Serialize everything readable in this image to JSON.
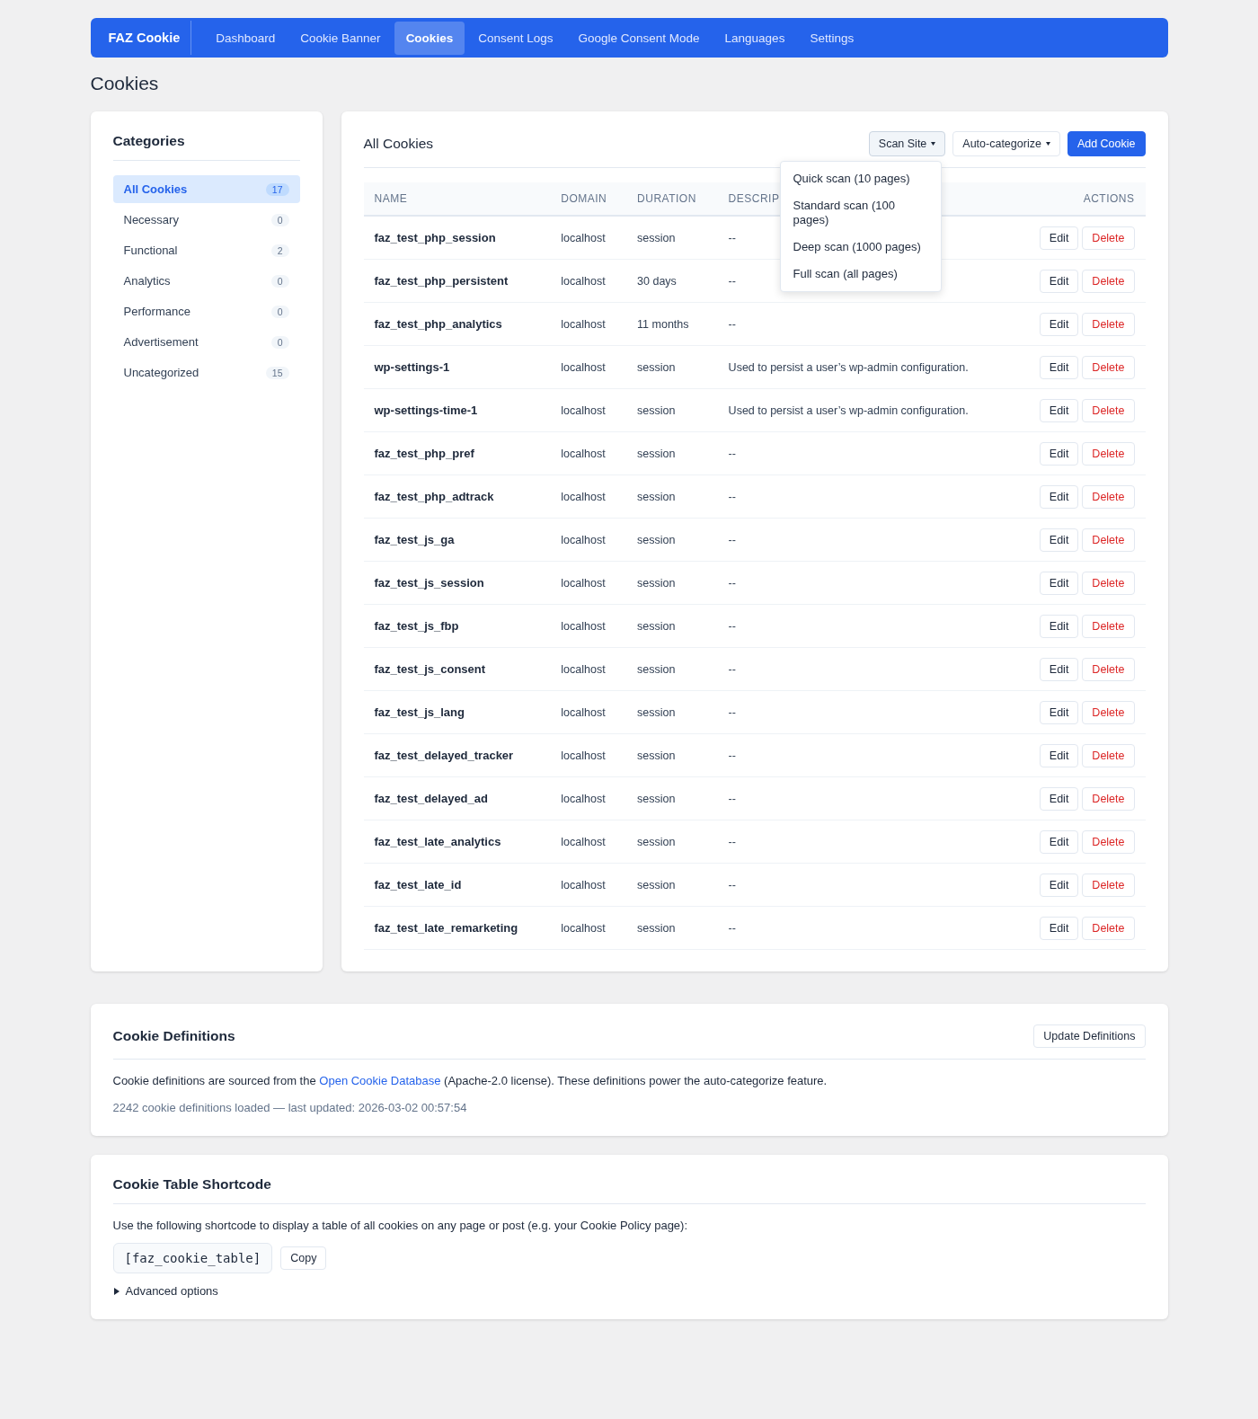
{
  "nav": {
    "brand": "FAZ Cookie",
    "items": [
      {
        "label": "Dashboard",
        "selected": false
      },
      {
        "label": "Cookie Banner",
        "selected": false
      },
      {
        "label": "Cookies",
        "selected": true
      },
      {
        "label": "Consent Logs",
        "selected": false
      },
      {
        "label": "Google Consent Mode",
        "selected": false
      },
      {
        "label": "Languages",
        "selected": false
      },
      {
        "label": "Settings",
        "selected": false
      }
    ]
  },
  "page_title": "Cookies",
  "categories": {
    "title": "Categories",
    "items": [
      {
        "label": "All Cookies",
        "count": "17",
        "selected": true
      },
      {
        "label": "Necessary",
        "count": "0",
        "selected": false
      },
      {
        "label": "Functional",
        "count": "2",
        "selected": false
      },
      {
        "label": "Analytics",
        "count": "0",
        "selected": false
      },
      {
        "label": "Performance",
        "count": "0",
        "selected": false
      },
      {
        "label": "Advertisement",
        "count": "0",
        "selected": false
      },
      {
        "label": "Uncategorized",
        "count": "15",
        "selected": false
      }
    ]
  },
  "cookies": {
    "title": "All Cookies",
    "scan_button": {
      "label": "Scan Site",
      "expanded": true
    },
    "auto_button": {
      "label": "Auto-categorize"
    },
    "add_button": {
      "label": "Add Cookie"
    },
    "scan_menu": [
      "Quick scan (10 pages)",
      "Standard scan (100 pages)",
      "Deep scan (1000 pages)",
      "Full scan (all pages)"
    ],
    "columns": [
      "NAME",
      "DOMAIN",
      "DURATION",
      "DESCRIP",
      "ACTIONS"
    ],
    "rows": [
      {
        "name": "faz_test_php_session",
        "domain": "localhost",
        "duration": "session",
        "description": "--",
        "edit": "Edit",
        "delete": "Delete"
      },
      {
        "name": "faz_test_php_persistent",
        "domain": "localhost",
        "duration": "30 days",
        "description": "--",
        "edit": "Edit",
        "delete": "Delete"
      },
      {
        "name": "faz_test_php_analytics",
        "domain": "localhost",
        "duration": "11 months",
        "description": "--",
        "edit": "Edit",
        "delete": "Delete"
      },
      {
        "name": "wp-settings-1",
        "domain": "localhost",
        "duration": "session",
        "description": "Used to persist a user’s wp-admin configuration.",
        "edit": "Edit",
        "delete": "Delete"
      },
      {
        "name": "wp-settings-time-1",
        "domain": "localhost",
        "duration": "session",
        "description": "Used to persist a user’s wp-admin configuration.",
        "edit": "Edit",
        "delete": "Delete"
      },
      {
        "name": "faz_test_php_pref",
        "domain": "localhost",
        "duration": "session",
        "description": "--",
        "edit": "Edit",
        "delete": "Delete"
      },
      {
        "name": "faz_test_php_adtrack",
        "domain": "localhost",
        "duration": "session",
        "description": "--",
        "edit": "Edit",
        "delete": "Delete"
      },
      {
        "name": "faz_test_js_ga",
        "domain": "localhost",
        "duration": "session",
        "description": "--",
        "edit": "Edit",
        "delete": "Delete"
      },
      {
        "name": "faz_test_js_session",
        "domain": "localhost",
        "duration": "session",
        "description": "--",
        "edit": "Edit",
        "delete": "Delete"
      },
      {
        "name": "faz_test_js_fbp",
        "domain": "localhost",
        "duration": "session",
        "description": "--",
        "edit": "Edit",
        "delete": "Delete"
      },
      {
        "name": "faz_test_js_consent",
        "domain": "localhost",
        "duration": "session",
        "description": "--",
        "edit": "Edit",
        "delete": "Delete"
      },
      {
        "name": "faz_test_js_lang",
        "domain": "localhost",
        "duration": "session",
        "description": "--",
        "edit": "Edit",
        "delete": "Delete"
      },
      {
        "name": "faz_test_delayed_tracker",
        "domain": "localhost",
        "duration": "session",
        "description": "--",
        "edit": "Edit",
        "delete": "Delete"
      },
      {
        "name": "faz_test_delayed_ad",
        "domain": "localhost",
        "duration": "session",
        "description": "--",
        "edit": "Edit",
        "delete": "Delete"
      },
      {
        "name": "faz_test_late_analytics",
        "domain": "localhost",
        "duration": "session",
        "description": "--",
        "edit": "Edit",
        "delete": "Delete"
      },
      {
        "name": "faz_test_late_id",
        "domain": "localhost",
        "duration": "session",
        "description": "--",
        "edit": "Edit",
        "delete": "Delete"
      },
      {
        "name": "faz_test_late_remarketing",
        "domain": "localhost",
        "duration": "session",
        "description": "--",
        "edit": "Edit",
        "delete": "Delete"
      }
    ]
  },
  "definitions": {
    "title": "Cookie Definitions",
    "button": "Update Definitions",
    "text_before": "Cookie definitions are sourced from the",
    "link": "Open Cookie Database",
    "text_after": "(Apache-2.0 license). These definitions power the auto-categorize feature.",
    "status": "2242 cookie definitions loaded — last updated: 2026-03-02 00:57:54"
  },
  "shortcode": {
    "title": "Cookie Table Shortcode",
    "description": "Use the following shortcode to display a table of all cookies on any page or post (e.g. your Cookie Policy page):",
    "code": "[faz_cookie_table]",
    "copy_button": "Copy",
    "advanced_label": "Advanced options",
    "advanced_expanded": false
  }
}
